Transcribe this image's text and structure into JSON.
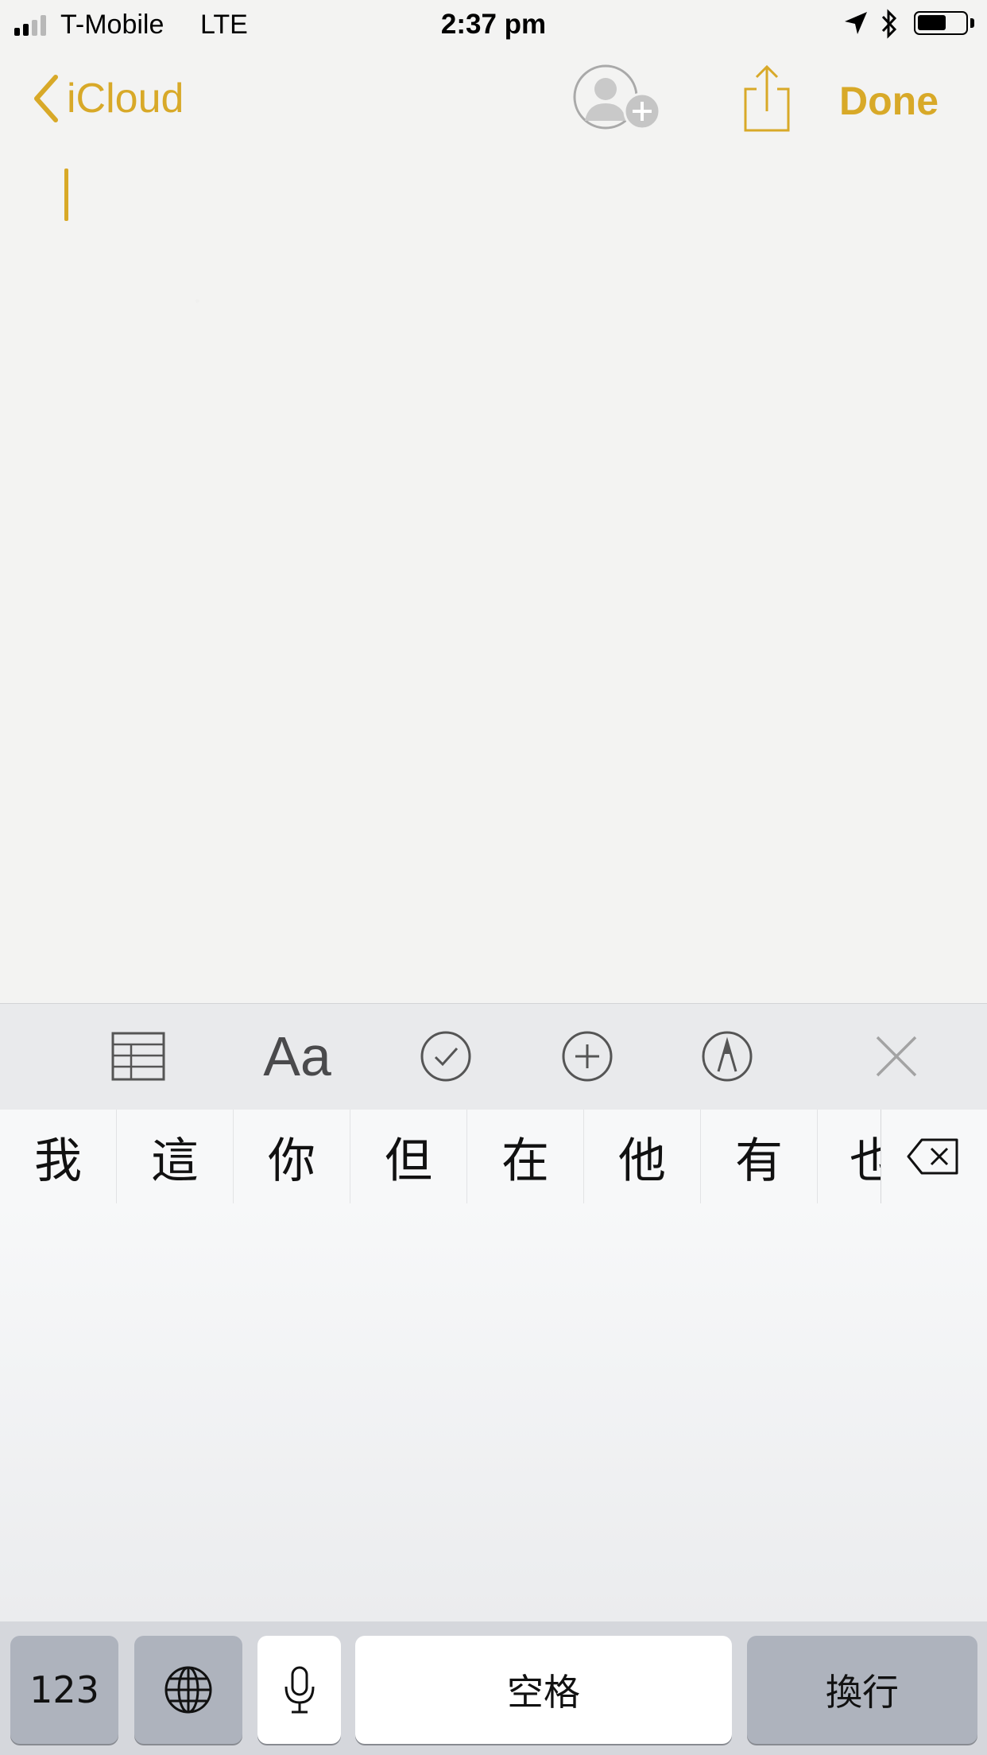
{
  "status_bar": {
    "carrier": "T-Mobile",
    "network": "LTE",
    "time": "2:37 pm",
    "signal_bars": 4,
    "signal_filled": 2,
    "battery_level": 0.55
  },
  "nav": {
    "back_label": "iCloud",
    "done_label": "Done",
    "accent_color": "#d8a928"
  },
  "toolbar": {
    "format_label": "Aa",
    "icons": [
      "table-icon",
      "format-icon",
      "checklist-icon",
      "add-icon",
      "markup-icon",
      "close-icon"
    ]
  },
  "candidates": [
    "我",
    "這",
    "你",
    "但",
    "在",
    "他",
    "有",
    "也"
  ],
  "keyboard": {
    "numbers_key": "123",
    "space_key": "空格",
    "return_key": "換行"
  }
}
